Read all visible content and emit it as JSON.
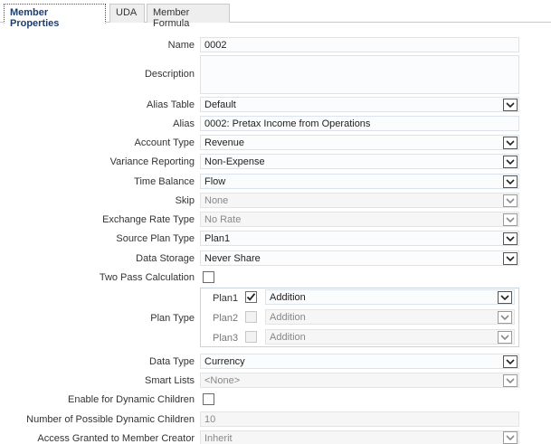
{
  "tabs": [
    {
      "label": "Member Properties",
      "active": true
    },
    {
      "label": "UDA",
      "active": false
    },
    {
      "label": "Member Formula",
      "active": false
    }
  ],
  "form": {
    "name": {
      "label": "Name",
      "value": "0002"
    },
    "description": {
      "label": "Description",
      "value": ""
    },
    "alias_table": {
      "label": "Alias Table",
      "value": "Default"
    },
    "alias": {
      "label": "Alias",
      "value": "0002: Pretax Income from Operations"
    },
    "account_type": {
      "label": "Account Type",
      "value": "Revenue"
    },
    "variance_reporting": {
      "label": "Variance Reporting",
      "value": "Non-Expense"
    },
    "time_balance": {
      "label": "Time Balance",
      "value": "Flow"
    },
    "skip": {
      "label": "Skip",
      "value": "None"
    },
    "exchange_rate_type": {
      "label": "Exchange Rate Type",
      "value": "No Rate"
    },
    "source_plan_type": {
      "label": "Source Plan Type",
      "value": "Plan1"
    },
    "data_storage": {
      "label": "Data Storage",
      "value": "Never Share"
    },
    "two_pass": {
      "label": "Two Pass Calculation",
      "checked": false
    },
    "plan_type": {
      "label": "Plan Type",
      "rows": [
        {
          "name": "Plan1",
          "checked": true,
          "aggregation": "Addition",
          "enabled": true
        },
        {
          "name": "Plan2",
          "checked": false,
          "aggregation": "Addition",
          "enabled": false
        },
        {
          "name": "Plan3",
          "checked": false,
          "aggregation": "Addition",
          "enabled": false
        }
      ]
    },
    "data_type": {
      "label": "Data Type",
      "value": "Currency"
    },
    "smart_lists": {
      "label": "Smart Lists",
      "value": "<None>"
    },
    "dynamic_children": {
      "label": "Enable for Dynamic Children",
      "checked": false
    },
    "num_dynamic_children": {
      "label": "Number of Possible Dynamic Children",
      "value": "10"
    },
    "access_granted": {
      "label": "Access Granted to Member Creator",
      "value": "Inherit"
    }
  }
}
